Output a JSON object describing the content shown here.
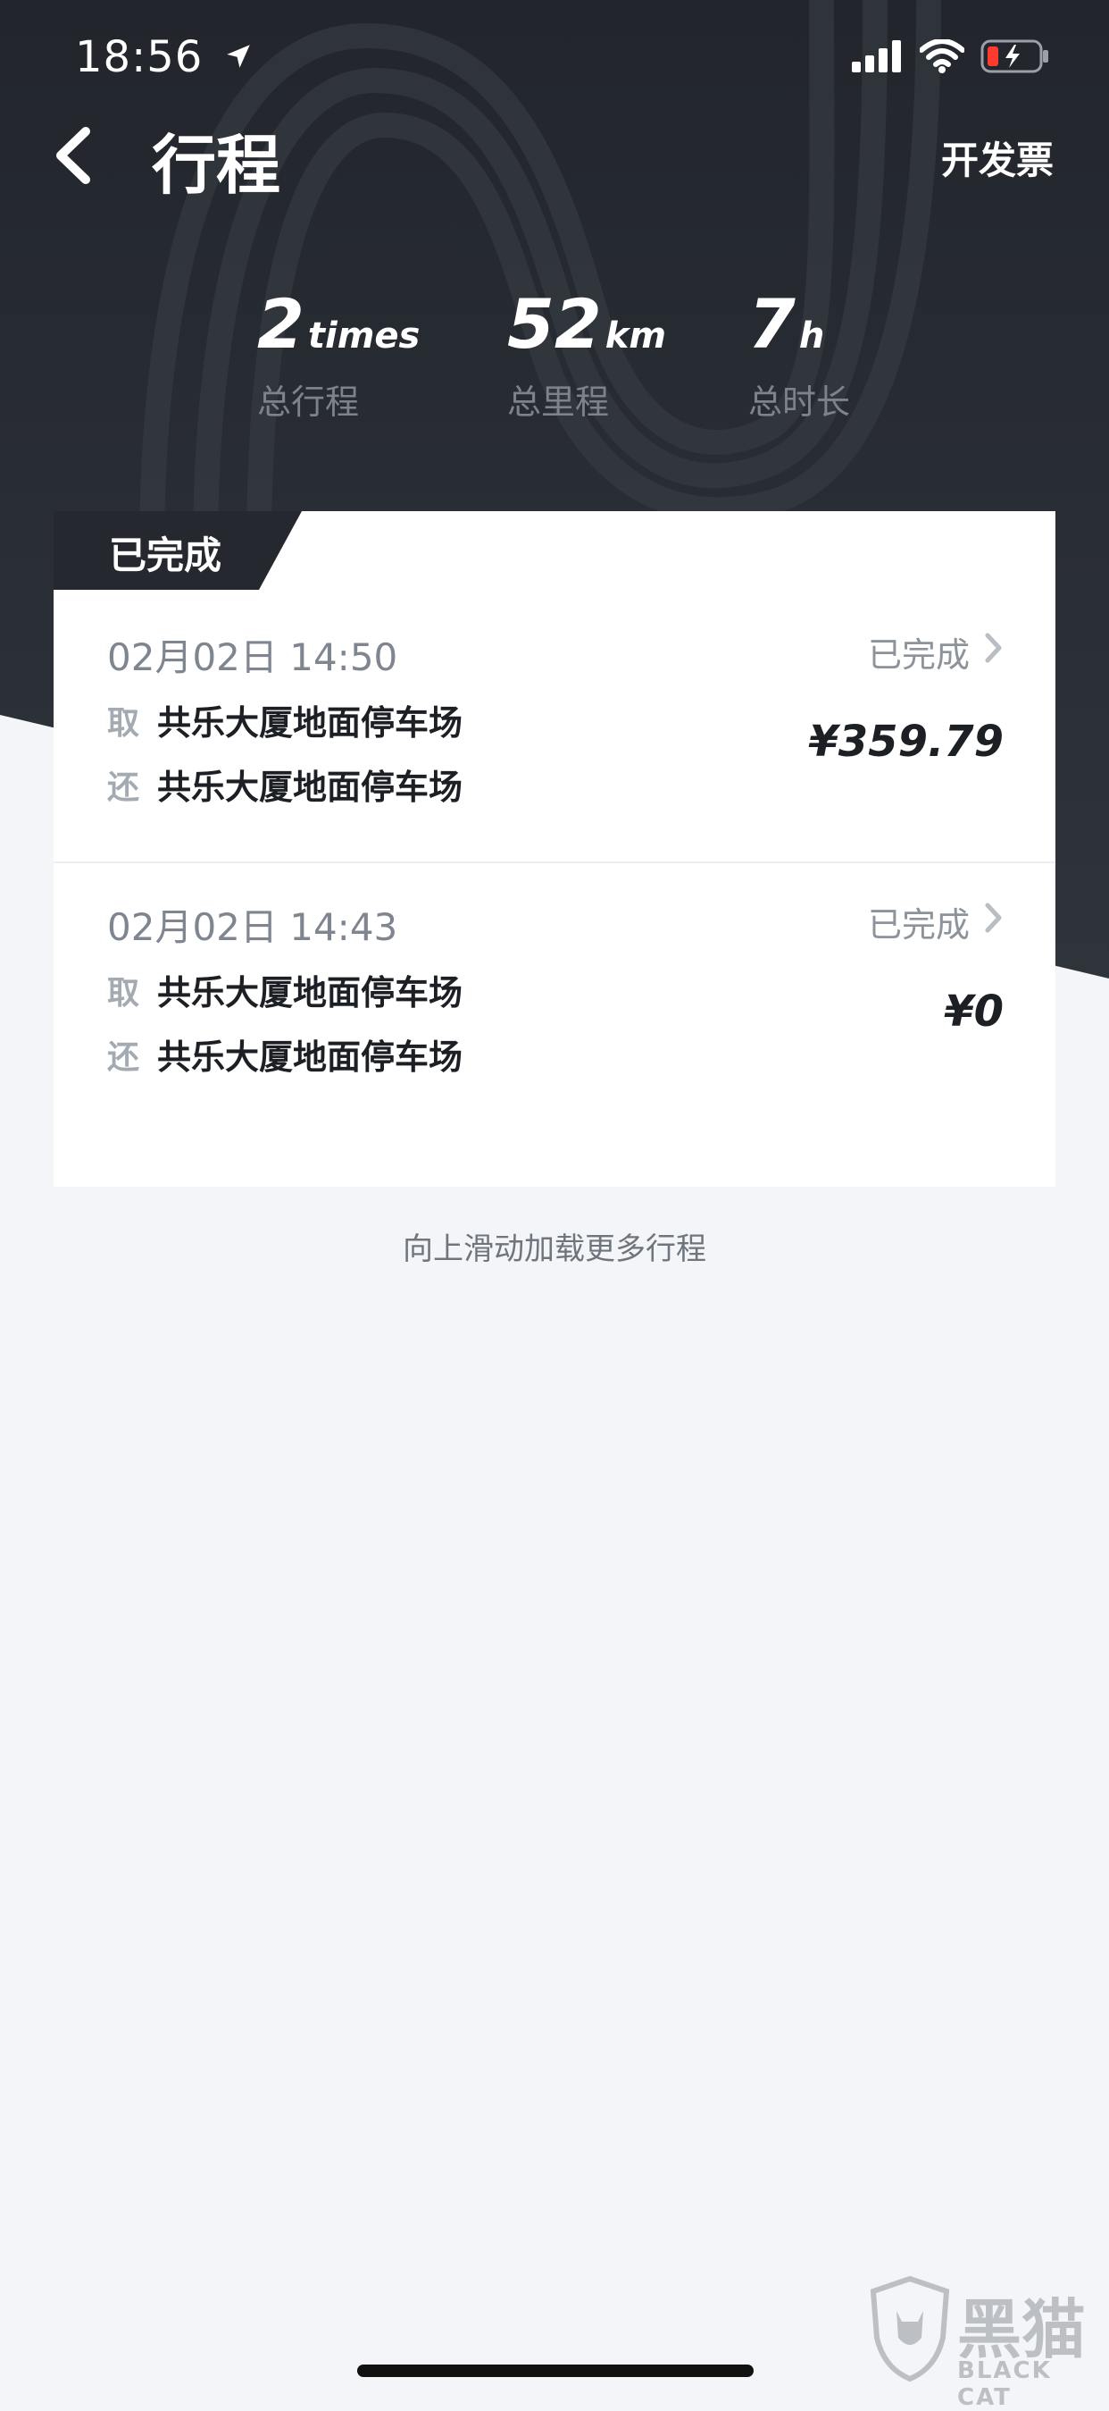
{
  "status_bar": {
    "time": "18:56",
    "icons": [
      "location-arrow-icon",
      "signal-icon",
      "wifi-icon",
      "battery-charging-icon"
    ]
  },
  "header": {
    "title": "行程",
    "right_action": "开发票",
    "back_icon": "chevron-left-icon"
  },
  "stats": [
    {
      "value": "2",
      "unit": "times",
      "label": "总行程"
    },
    {
      "value": "52",
      "unit": "km",
      "label": "总里程"
    },
    {
      "value": "7",
      "unit": "h",
      "label": "总时长"
    }
  ],
  "card": {
    "section_tag": "已完成",
    "trips": [
      {
        "datetime": "02月02日 14:50",
        "status": "已完成",
        "pickup_tag": "取",
        "pickup": "共乐大厦地面停车场",
        "return_tag": "还",
        "return": "共乐大厦地面停车场",
        "price": "¥359.79"
      },
      {
        "datetime": "02月02日 14:43",
        "status": "已完成",
        "pickup_tag": "取",
        "pickup": "共乐大厦地面停车场",
        "return_tag": "还",
        "return": "共乐大厦地面停车场",
        "price": "¥0"
      }
    ]
  },
  "footer": {
    "load_more": "向上滑动加载更多行程"
  },
  "watermark": {
    "cn": "黑猫",
    "en": "BLACK CAT"
  },
  "colors": {
    "header_bg": "#22262c",
    "page_bg": "#f4f5f9",
    "card_bg": "#ffffff",
    "muted_text": "#7f8690"
  }
}
